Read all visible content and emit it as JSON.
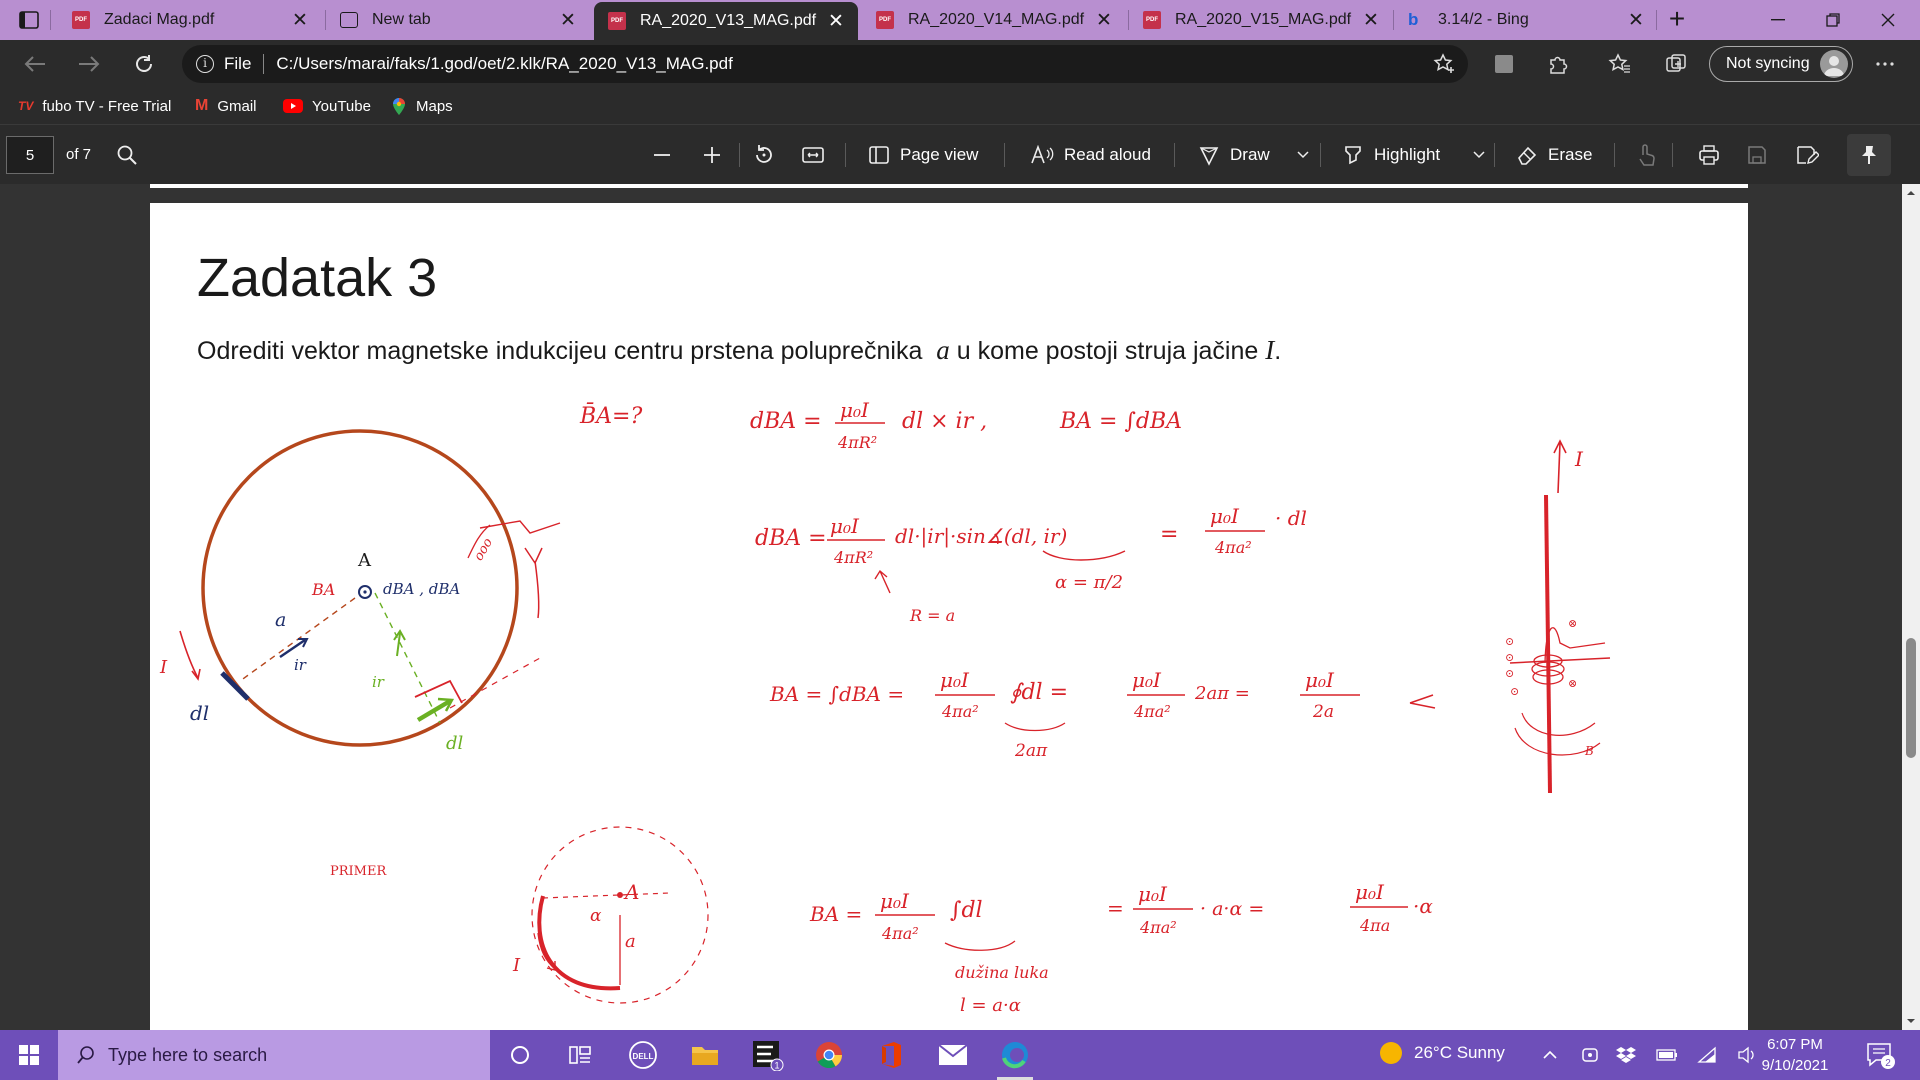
{
  "browser": {
    "tabs": [
      {
        "label": "Zadaci Mag.pdf",
        "icon": "pdf-icon",
        "active": false
      },
      {
        "label": "New tab",
        "icon": "new-tab-page-icon",
        "active": false
      },
      {
        "label": "RA_2020_V13_MAG.pdf",
        "icon": "pdf-icon",
        "active": true
      },
      {
        "label": "RA_2020_V14_MAG.pdf",
        "icon": "pdf-icon",
        "active": false
      },
      {
        "label": "RA_2020_V15_MAG.pdf",
        "icon": "pdf-icon",
        "active": false
      },
      {
        "label": "3.14/2 - Bing",
        "icon": "bing-icon",
        "active": false
      }
    ],
    "pdf_badge": "PDF",
    "address": {
      "scheme_label": "File",
      "url": "C:/Users/marai/faks/1.god/oet/2.klk/RA_2020_V13_MAG.pdf"
    },
    "profile": {
      "label": "Not syncing"
    },
    "favorites": [
      {
        "label": "fubo TV - Free Trial",
        "icon": "fubo-tv-icon",
        "badge": "TV"
      },
      {
        "label": "Gmail",
        "icon": "gmail-icon",
        "badge": "M"
      },
      {
        "label": "YouTube",
        "icon": "youtube-icon"
      },
      {
        "label": "Maps",
        "icon": "maps-icon"
      }
    ]
  },
  "pdf_toolbar": {
    "page_number": "5",
    "page_count": "of 7",
    "page_view": "Page view",
    "read_aloud": "Read aloud",
    "draw": "Draw",
    "highlight": "Highlight",
    "erase": "Erase"
  },
  "document": {
    "heading": "Zadatak 3",
    "problem_text": "Odrediti vektor magnetske indukcijeu centru prstena poluprečnika",
    "problem_var_a": "a",
    "problem_text_2": "u kome postoji struja jačine",
    "problem_var_i": "I",
    "problem_end": ".",
    "annotations": {
      "question": "B̄A=?",
      "primer": "PRIMER",
      "label_A": "A",
      "label_A2": "A",
      "label_I": "I",
      "label_I2": "I",
      "label_I3": "I",
      "label_a": "a",
      "label_a2": "a",
      "label_alpha": "α",
      "label_dl": "dl",
      "label_dl2": "dl",
      "label_ir": "ir",
      "label_ir2": "ir",
      "label_ba": "BA",
      "label_dba": "dBA , dBA",
      "eq1_left": "dBA =",
      "eq1_num": "μ₀I",
      "eq1_den": "4πR²",
      "eq1_right": "dl × ir ,",
      "eq1b": "BA = ∫dBA",
      "eq2_left": "dBA =",
      "eq2_num": "μ₀I",
      "eq2_den": "4πR²",
      "eq2_mid": "dl·|ir|·sin∡(dl, ir)",
      "eq2_under": "α = π/2",
      "eq2_eq": "=",
      "eq2_rnum": "μ₀I",
      "eq2_rden": "4πa²",
      "eq2_rtail": "· dl",
      "eq2_note": "R = a",
      "eq3_left": "BA = ∫dBA =",
      "eq3_num": "μ₀I",
      "eq3_den": "4πa²",
      "eq3_int": "∮dl =",
      "eq3_under": "2aπ",
      "eq3_num2": "μ₀I",
      "eq3_den2": "4πa²",
      "eq3_tail": "2aπ =",
      "eq3_rnum": "μ₀I",
      "eq3_rden": "2a",
      "eq4_left": "BA =",
      "eq4_num": "μ₀I",
      "eq4_den": "4πa²",
      "eq4_int": "∫dl",
      "eq4_eq": "=",
      "eq4_num2": "μ₀I",
      "eq4_den2": "4πa²",
      "eq4_mid": "· a·α =",
      "eq4_rnum": "μ₀I",
      "eq4_rden": "4πa",
      "eq4_tail": "·α",
      "eq4_under1": "dužina luka",
      "eq4_under2": "l = a·α",
      "side_B": "B"
    }
  },
  "taskbar": {
    "search_placeholder": "Type here to search",
    "weather": "26°C  Sunny",
    "time": "6:07 PM",
    "date": "9/10/2021",
    "notification_count": "2",
    "app_badge": "1",
    "dell_label": "DELL"
  },
  "colors": {
    "tab_strip": "#b88fd0",
    "taskbar": "#6e4fb9",
    "ink_red": "#d8232a",
    "ink_blue": "#1f2f6b",
    "ink_green": "#6ab023",
    "ring": "#b5471c"
  }
}
